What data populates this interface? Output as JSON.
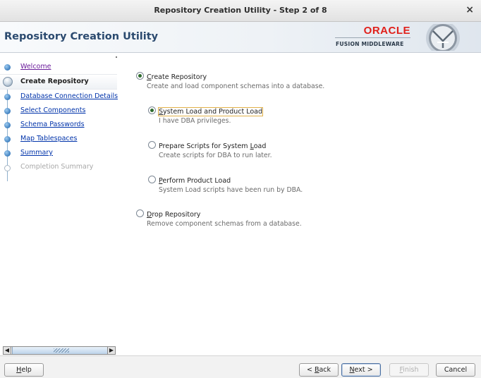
{
  "window": {
    "title": "Repository Creation Utility - Step 2 of 8",
    "close_glyph": "×"
  },
  "banner": {
    "app_title": "Repository Creation Utility",
    "brand": "ORACLE",
    "brand_sub": "FUSION MIDDLEWARE",
    "brand_color": "#e0201b"
  },
  "sidebar": {
    "items": [
      {
        "label": "Welcome",
        "state": "visited"
      },
      {
        "label": "Create Repository",
        "state": "current"
      },
      {
        "label": "Database Connection Details",
        "state": "link"
      },
      {
        "label": "Select Components",
        "state": "link"
      },
      {
        "label": "Schema Passwords",
        "state": "link"
      },
      {
        "label": "Map Tablespaces",
        "state": "link"
      },
      {
        "label": "Summary",
        "state": "link"
      },
      {
        "label": "Completion Summary",
        "state": "disabled"
      }
    ],
    "scroll_left": "◀",
    "scroll_right": "▶"
  },
  "options": {
    "create": {
      "pre": "",
      "mnemonic": "C",
      "post": "reate Repository",
      "desc": "Create and load component schemas into a database.",
      "selected": true
    },
    "system_load": {
      "pre": "",
      "mnemonic": "S",
      "post": "ystem Load and Product Load",
      "desc": "I have DBA privileges.",
      "selected": true
    },
    "prepare": {
      "pre": "Prepare Scripts for System ",
      "mnemonic": "L",
      "post": "oad",
      "desc": "Create scripts for DBA to run later.",
      "selected": false
    },
    "perform": {
      "pre": "",
      "mnemonic": "P",
      "post": "erform Product Load",
      "desc": "System Load scripts have been run by DBA.",
      "selected": false
    },
    "drop": {
      "pre": "",
      "mnemonic": "D",
      "post": "rop Repository",
      "desc": "Remove component schemas from a database.",
      "selected": false
    }
  },
  "buttons": {
    "help": {
      "mnemonic": "H",
      "post": "elp"
    },
    "back": {
      "pre": "< ",
      "mnemonic": "B",
      "post": "ack"
    },
    "next": {
      "mnemonic": "N",
      "post": "ext >"
    },
    "finish": {
      "mnemonic": "F",
      "post": "inish"
    },
    "cancel": {
      "label": "Cancel"
    }
  }
}
